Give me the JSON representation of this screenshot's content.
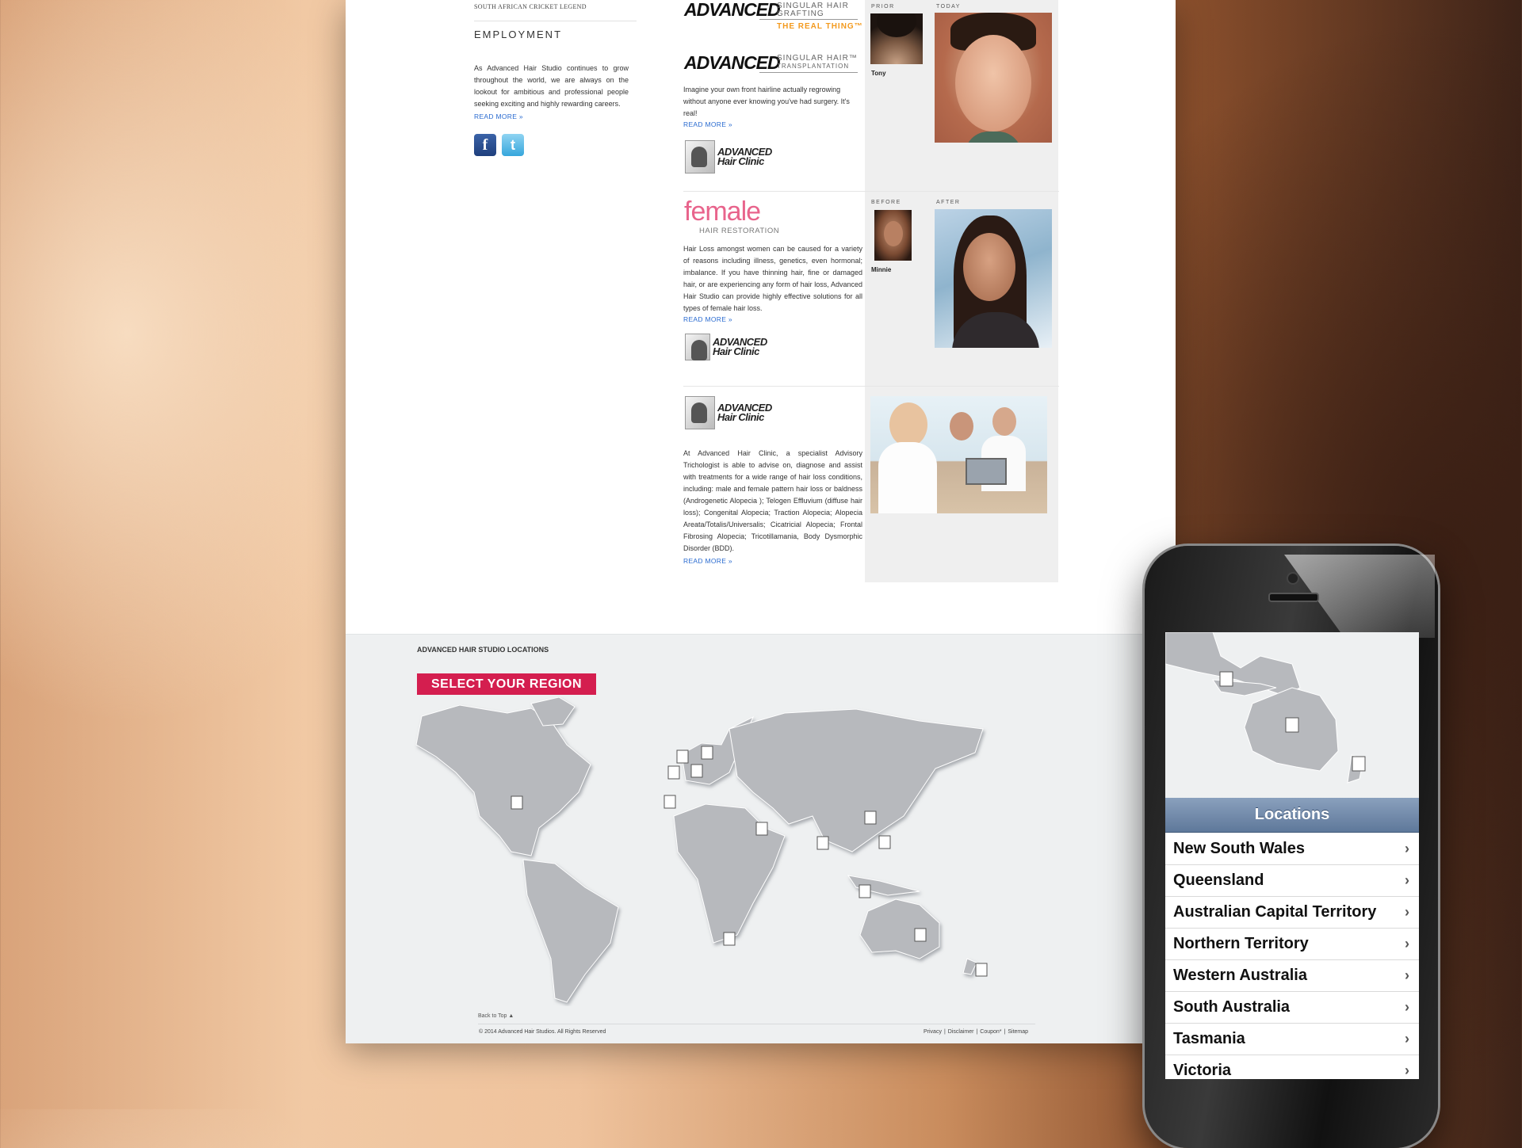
{
  "page": {
    "legend_caption": "SOUTH AFRICAN CRICKET LEGEND",
    "employment": {
      "title": "EMPLOYMENT",
      "text": "As Advanced Hair Studio continues to grow throughout the world, we are always on the lookout for ambitious and professional people seeking exciting and highly rewarding careers.",
      "read_more": "READ MORE »"
    },
    "social": {
      "facebook_icon": "facebook-icon",
      "twitter_icon": "twitter-icon"
    },
    "grafting": {
      "brand": "ADVANCED",
      "sub1": "SINGULAR HAIR",
      "sub2": "GRAFTING",
      "tagline": "THE REAL THING™"
    },
    "transplant": {
      "brand": "ADVANCED",
      "sub1": "SINGULAR HAIR™",
      "sub2": "TRANSPLANTATION",
      "text": "Imagine your own front hairline actually regrowing without anyone ever knowing you've had surgery. It's real!",
      "read_more": "READ MORE »"
    },
    "clinic_logo": {
      "line1": "ADVANCED",
      "line2": "Hair Clinic"
    },
    "tony": {
      "label_prior": "PRIOR",
      "label_today": "TODAY",
      "name": "Tony"
    },
    "female": {
      "logo_word": "female",
      "logo_sub": "HAIR RESTORATION",
      "text": "Hair Loss amongst women can be caused for a variety of reasons including illness, genetics, even hormonal; imbalance. If you have thinning hair, fine or damaged hair, or are experiencing any form of hair loss, Advanced Hair Studio can provide highly effective solutions for all types of female hair loss.",
      "read_more": "READ MORE »"
    },
    "minnie": {
      "label_before": "BEFORE",
      "label_after": "AFTER",
      "name": "Minnie"
    },
    "clinic": {
      "text": "At Advanced Hair Clinic, a specialist Advisory Trichologist is able to advise on, diagnose and assist with treatments for a wide range of hair loss conditions, including: male and female pattern hair loss or baldness (Androgenetic Alopecia ); Telogen Effluvium (diffuse hair loss); Congenital Alopecia; Traction Alopecia; Alopecia Areata/Totalis/Universalis; Cicatricial Alopecia; Frontal Fibrosing Alopecia; Tricotillamania, Body Dysmorphic Disorder (BDD).",
      "read_more": "READ MORE »"
    },
    "locations": {
      "title": "ADVANCED HAIR STUDIO LOCATIONS",
      "button": "SELECT YOUR REGION",
      "marker_icon": "studio-marker-icon"
    },
    "footer": {
      "back_to_top": "Back to Top ▲",
      "copyright": "© 2014 Advanced Hair Studios. All Rights Reserved",
      "links": [
        "Privacy",
        "Disclaimer",
        "Coupon*",
        "Sitemap"
      ]
    }
  },
  "mobile": {
    "header": "Locations",
    "chevron": "›",
    "items": [
      "New South Wales",
      "Queensland",
      "Australian Capital Territory",
      "Northern Territory",
      "Western Australia",
      "South Australia",
      "Tasmania",
      "Victoria"
    ]
  },
  "colors": {
    "accent": "#d41e4f",
    "link": "#2a6bd0",
    "grafting_orange": "#f39a1e",
    "female_pink": "#e8648c",
    "mobile_header": "#6f87a8"
  }
}
